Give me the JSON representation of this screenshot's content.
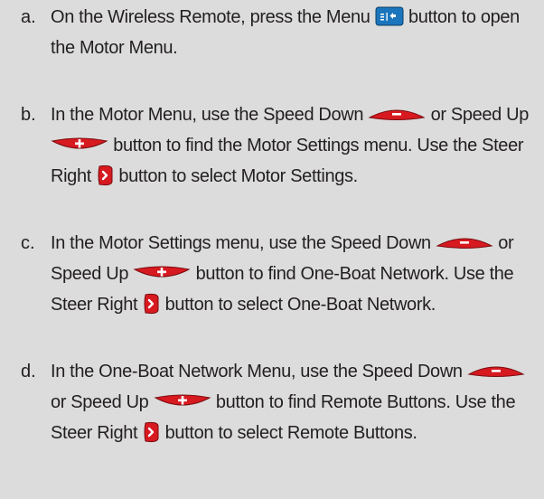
{
  "steps": [
    {
      "letter": "a.",
      "parts": [
        {
          "t": "text",
          "v": "On the Wireless Remote, press the Menu "
        },
        {
          "t": "icon",
          "v": "menu-button-icon"
        },
        {
          "t": "text",
          "v": " button to open the Motor Menu."
        }
      ]
    },
    {
      "letter": "b.",
      "parts": [
        {
          "t": "text",
          "v": "In the Motor Menu, use the Speed Down "
        },
        {
          "t": "icon",
          "v": "speed-down-button-icon"
        },
        {
          "t": "text",
          "v": " or Speed Up "
        },
        {
          "t": "icon",
          "v": "speed-up-button-icon"
        },
        {
          "t": "text",
          "v": " button to find the Motor Settings menu. Use the Steer Right "
        },
        {
          "t": "icon",
          "v": "steer-right-button-icon"
        },
        {
          "t": "text",
          "v": " button to select Motor Settings."
        }
      ]
    },
    {
      "letter": "c.",
      "parts": [
        {
          "t": "text",
          "v": "In the Motor Settings menu, use the Speed Down "
        },
        {
          "t": "icon",
          "v": "speed-down-button-icon"
        },
        {
          "t": "text",
          "v": " or Speed Up "
        },
        {
          "t": "icon",
          "v": "speed-up-button-icon"
        },
        {
          "t": "text",
          "v": " button to find One-Boat Network. Use the Steer Right "
        },
        {
          "t": "icon",
          "v": "steer-right-button-icon"
        },
        {
          "t": "text",
          "v": " button to select One-Boat Network."
        }
      ]
    },
    {
      "letter": "d.",
      "parts": [
        {
          "t": "text",
          "v": "In the One-Boat Network Menu, use the Speed Down "
        },
        {
          "t": "icon",
          "v": "speed-down-button-icon"
        },
        {
          "t": "text",
          "v": " or Speed Up "
        },
        {
          "t": "icon",
          "v": "speed-up-button-icon"
        },
        {
          "t": "text",
          "v": " button to find Remote Buttons. Use the Steer Right "
        },
        {
          "t": "icon",
          "v": "steer-right-button-icon"
        },
        {
          "t": "text",
          "v": " button to select Remote Buttons."
        }
      ]
    }
  ],
  "colors": {
    "background": "#dcdcdc",
    "text": "#231f20",
    "button_red": "#d71920",
    "button_blue": "#1b75bc"
  }
}
